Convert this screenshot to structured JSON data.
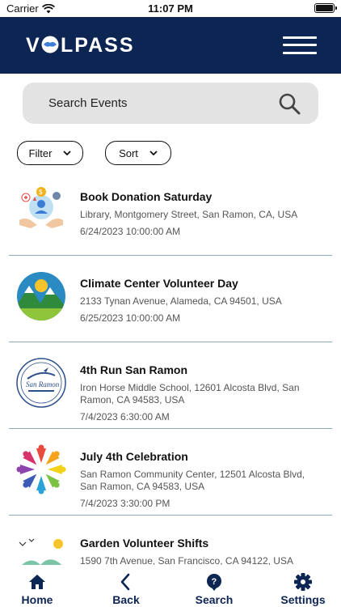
{
  "status_bar": {
    "carrier": "Carrier",
    "time": "11:07 PM"
  },
  "header": {
    "logo": "VOLPASS"
  },
  "search": {
    "placeholder": "Search Events"
  },
  "controls": {
    "filter_label": "Filter",
    "sort_label": "Sort"
  },
  "events": [
    {
      "title": "Book Donation Saturday",
      "address": "Library, Montgomery Street, San Ramon, CA, USA",
      "date": "6/24/2023  10:00:00 AM"
    },
    {
      "title": "Climate Center Volunteer Day",
      "address": "2133 Tynan Avenue, Alameda, CA 94501, USA",
      "date": "6/25/2023  10:00:00 AM"
    },
    {
      "title": "4th Run San Ramon",
      "address": "Iron Horse Middle School, 12601 Alcosta Blvd, San Ramon, CA 94583, USA",
      "date": "7/4/2023  6:30:00 AM"
    },
    {
      "title": "July 4th Celebration",
      "address": "San Ramon Community Center, 12501 Alcosta Blvd, San Ramon, CA 94583, USA",
      "date": "7/4/2023  3:30:00 PM"
    },
    {
      "title": "Garden Volunteer Shifts",
      "address": "1590 7th Avenue, San Francisco, CA 94122, USA",
      "date": ""
    }
  ],
  "tabbar": {
    "home": "Home",
    "back": "Back",
    "search": "Search",
    "settings": "Settings"
  },
  "colors": {
    "header_bg": "#0d2553",
    "divider": "#8fa8c4",
    "search_bg": "#e3e3e3"
  }
}
